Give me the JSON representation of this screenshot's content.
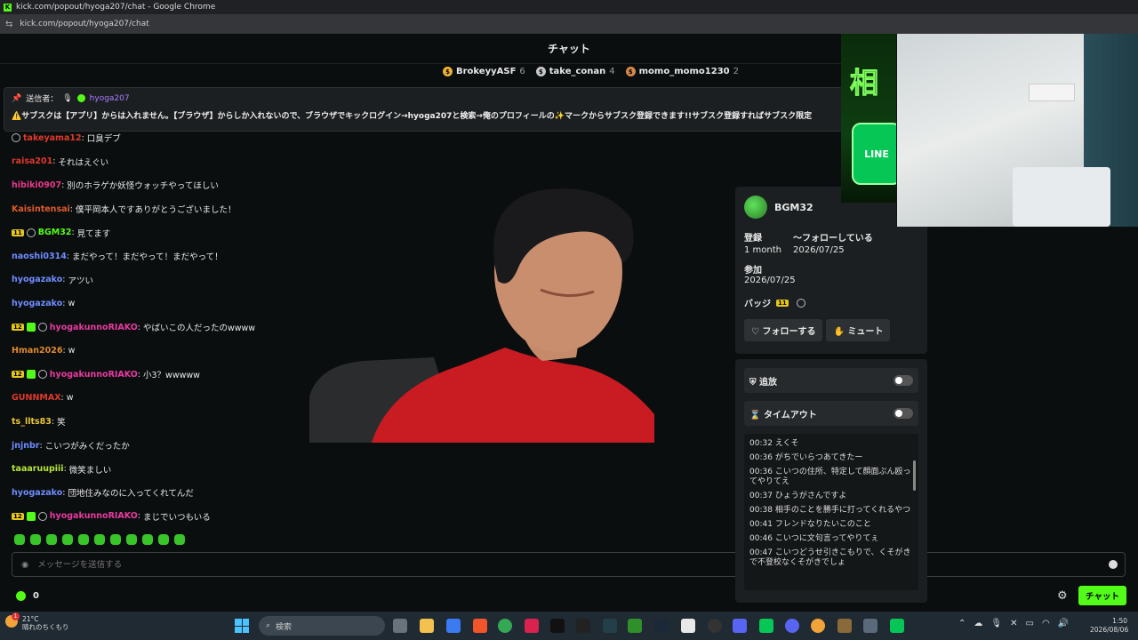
{
  "browser": {
    "title": "kick.com/popout/hyoga207/chat - Google Chrome",
    "favicon": "K",
    "url": "kick.com/popout/hyoga207/chat"
  },
  "chat": {
    "header": "チャット",
    "leaderboard": [
      {
        "name": "BrokeyyASF",
        "count": "6",
        "color": "#f0b433"
      },
      {
        "name": "take_conan",
        "count": "4",
        "color": "#c8c8c8"
      },
      {
        "name": "momo_momo1230",
        "count": "2",
        "color": "#d98a4a"
      }
    ],
    "pinned": {
      "label": "送信者：",
      "user": "hyoga207",
      "text": "⚠️サブスクは【アプリ】からは入れません。【ブラウザ】からしか入れないので、ブラウザでキックログイン→hyoga207と検索→俺のプロフィールの✨マークからサブスク登録できます!!サブスク登録すればサブスク限定"
    },
    "messages": [
      {
        "user": "takeyama12",
        "color": "#e0392b",
        "text": "口臭デブ",
        "badges": [
          "round"
        ]
      },
      {
        "user": "raisa201",
        "color": "#e0392b",
        "text": "それはえぐい",
        "badges": []
      },
      {
        "user": "hibiki0907",
        "color": "#e83a8a",
        "text": "別のホラゲか妖怪ウォッチやってほしい",
        "badges": []
      },
      {
        "user": "Kaisintensai",
        "color": "#e05a2b",
        "text": "僕平岡本人ですありがとうございました！",
        "badges": []
      },
      {
        "user": "BGM32",
        "color": "#53fc18",
        "text": "見てます",
        "badges": [
          "sub:11",
          "round"
        ]
      },
      {
        "user": "naoshi0314",
        "color": "#6f8cff",
        "text": "まだやって！まだやって！まだやって！",
        "badges": []
      },
      {
        "user": "hyogazako",
        "color": "#6f8cff",
        "text": "アツい",
        "badges": []
      },
      {
        "user": "hyogazako",
        "color": "#6f8cff",
        "text": "w",
        "badges": []
      },
      {
        "user": "hyogakunnoRIAKO",
        "color": "#e83aa0",
        "text": "やばいこの人だったのwwww",
        "badges": [
          "sub:12",
          "gift",
          "round"
        ]
      },
      {
        "user": "Hman2026",
        "color": "#e0892b",
        "text": "w",
        "badges": []
      },
      {
        "user": "hyogakunnoRIAKO",
        "color": "#e83aa0",
        "text": "小3？wwwww",
        "badges": [
          "sub:12",
          "gift",
          "round"
        ]
      },
      {
        "user": "GUNNMAX",
        "color": "#e0392b",
        "text": "w",
        "badges": []
      },
      {
        "user": "ts_llts83",
        "color": "#e8c43a",
        "text": "笑",
        "badges": []
      },
      {
        "user": "jnjnbr",
        "color": "#6f8cff",
        "text": "こいつがみくだったか",
        "badges": []
      },
      {
        "user": "taaaruupiii",
        "color": "#b7e83a",
        "text": "微笑ましい",
        "badges": []
      },
      {
        "user": "hyogazako",
        "color": "#6f8cff",
        "text": "団地住みなのに入ってくれてんだ",
        "badges": []
      },
      {
        "user": "hyogakunnoRIAKO",
        "color": "#e83aa0",
        "text": "まじでいつもいる",
        "badges": [
          "sub:12",
          "gift",
          "round"
        ]
      }
    ],
    "emote_count": 11,
    "input_placeholder": "メッセージを送信する",
    "points": "0",
    "send_label": "チャット"
  },
  "user_card": {
    "username": "BGM32",
    "registered_label": "登録",
    "registered_value": "1 month",
    "following_label": "〜フォローしている",
    "following_date": "2026/07/25",
    "join_label": "参加",
    "join_date": "2026/07/25",
    "badges_label": "バッジ",
    "badge_sub": "11",
    "follow_label": "フォローする",
    "mute_label": "ミュート",
    "close": "×"
  },
  "mod_panel": {
    "ban_label": "追放",
    "timeout_label": "タイムアウト",
    "history": [
      {
        "time": "00:32",
        "text": "えくそ"
      },
      {
        "time": "00:36",
        "text": "がちでいらつあてきたー"
      },
      {
        "time": "00:36",
        "text": "こいつの住所、特定して顔面ぶん殴ってやりてえ"
      },
      {
        "time": "00:37",
        "text": "ひょうがさんですよ"
      },
      {
        "time": "00:38",
        "text": "相手のことを勝手に打ってくれるやつ"
      },
      {
        "time": "00:41",
        "text": "フレンドなりたいこのこと"
      },
      {
        "time": "00:46",
        "text": "こいつに文句言ってやりてぇ"
      },
      {
        "time": "00:47",
        "text": "こいつどうせ引きこもりで、くそがきで不登校なくそがきでしょ"
      }
    ]
  },
  "banner": {
    "char": "相",
    "line_label": "LINE"
  },
  "taskbar": {
    "weather_temp": "21°C",
    "weather_desc": "晴れのちくもり",
    "weather_badge": "1",
    "search_placeholder": "検索",
    "time": "1:50",
    "date": "2026/08/06"
  }
}
